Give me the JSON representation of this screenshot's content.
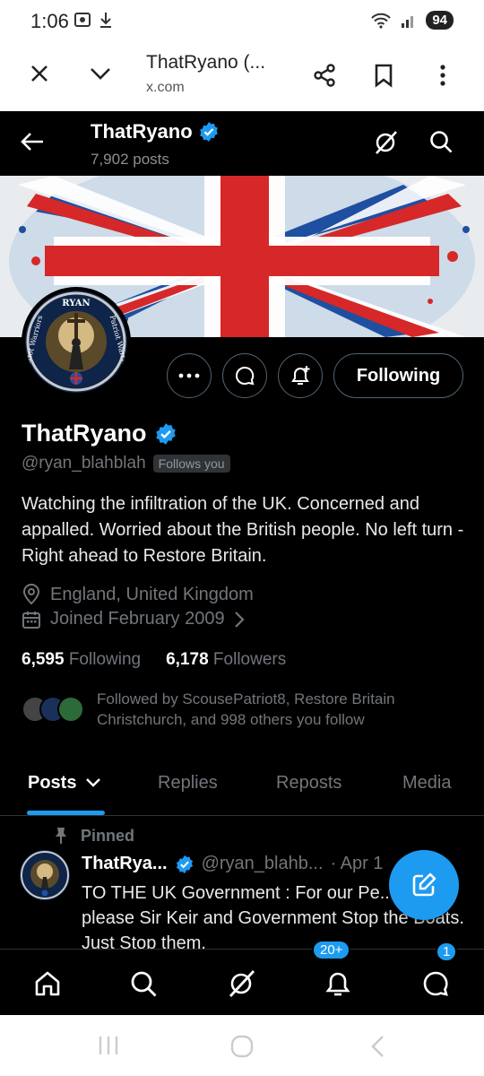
{
  "status_bar": {
    "time": "1:06",
    "battery": "94"
  },
  "browser": {
    "title": "ThatRyano (...",
    "url": "x.com"
  },
  "header": {
    "name": "ThatRyano",
    "post_count": "7,902 posts"
  },
  "avatar_text": {
    "top": "RYAN",
    "left": "Patriot Warriors",
    "right": "Patriot Warriors"
  },
  "profile": {
    "name": "ThatRyano",
    "handle": "@ryan_blahblah",
    "follows_you": "Follows you",
    "bio": "Watching the infiltration of the UK. Concerned and appalled. Worried about the British people. No left turn - Right ahead to Restore Britain.",
    "location": "England, United Kingdom",
    "joined": "Joined February 2009",
    "following_count": "6,595",
    "following_label": "Following",
    "followers_count": "6,178",
    "followers_label": "Followers",
    "followed_by": "Followed by ScousePatriot8, Restore Britain Christchurch, and 998 others you follow"
  },
  "actions": {
    "follow_label": "Following"
  },
  "tabs": [
    {
      "label": "Posts"
    },
    {
      "label": "Replies"
    },
    {
      "label": "Reposts"
    },
    {
      "label": "Media"
    }
  ],
  "pinned_tweet": {
    "pinned_label": "Pinned",
    "author": "ThatRya...",
    "handle": "@ryan_blahb...",
    "date": "· Apr 1",
    "text": "TO THE UK Government : For our Pe... sake please Sir Keir and Government Stop the Boats. Just Stop them."
  },
  "bottom_nav": {
    "notifications_badge": "20+",
    "messages_badge": "1"
  },
  "colors": {
    "accent": "#1d9bf0",
    "background": "#000000",
    "muted": "#71767b"
  },
  "icons": [
    "close-icon",
    "chevron-down-icon",
    "share-icon",
    "bookmark-icon",
    "more-vert-icon",
    "back-arrow-icon",
    "grok-icon",
    "search-icon",
    "verified-icon",
    "more-horiz-icon",
    "message-icon",
    "notify-plus-icon",
    "location-icon",
    "calendar-icon",
    "chevron-right-icon",
    "pin-icon",
    "compose-icon",
    "home-icon",
    "bell-icon",
    "mail-icon"
  ]
}
